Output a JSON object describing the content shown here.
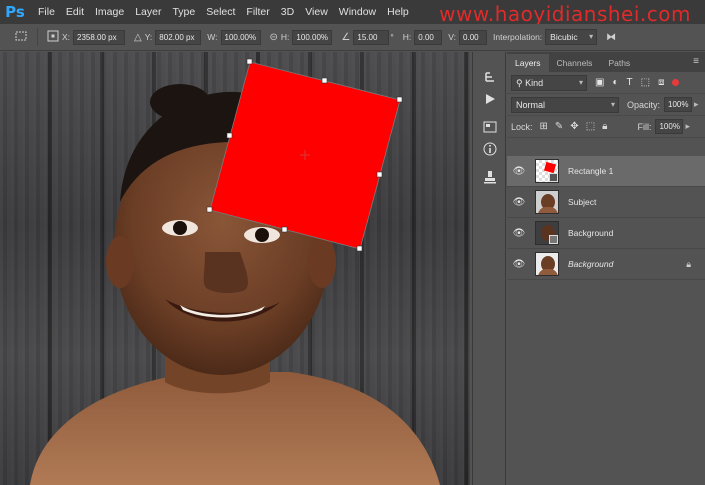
{
  "app": {
    "logo": "Ps"
  },
  "menu": [
    "File",
    "Edit",
    "Image",
    "Layer",
    "Type",
    "Select",
    "Filter",
    "3D",
    "View",
    "Window",
    "Help"
  ],
  "watermark": "www.haoyidianshei.com",
  "options": {
    "x_label": "X:",
    "x_value": "2358.00 px",
    "y_label": "Y:",
    "y_value": "802.00 px",
    "w_label": "W:",
    "w_value": "100.00%",
    "h_label": "H:",
    "h_value": "100.00%",
    "angle_value": "15.00",
    "hskew_label": "H:",
    "hskew_value": "0.00",
    "vskew_label": "V:",
    "vskew_value": "0.00",
    "interp_label": "Interpolation:",
    "interp_value": "Bicubic"
  },
  "panel": {
    "tabs": [
      "Layers",
      "Channels",
      "Paths"
    ],
    "kind_label": "Kind",
    "blend_mode": "Normal",
    "opacity_label": "Opacity:",
    "opacity_value": "100%",
    "lock_label": "Lock:",
    "fill_label": "Fill:",
    "fill_value": "100%"
  },
  "layers": [
    {
      "name": "Rectangle 1",
      "selected": true,
      "italic": false
    },
    {
      "name": "Subject",
      "selected": false,
      "italic": false
    },
    {
      "name": "Background",
      "selected": false,
      "italic": false
    },
    {
      "name": "Background",
      "selected": false,
      "italic": true,
      "locked": true
    }
  ],
  "colors": {
    "accent_blue": "#31a8ff",
    "shape_red": "#ff0000",
    "watermark_red": "#ff2828"
  },
  "icons": {
    "toolstrip": [
      "history-icon",
      "play-icon",
      "properties-icon",
      "info-icon",
      "clone-source-icon"
    ]
  }
}
